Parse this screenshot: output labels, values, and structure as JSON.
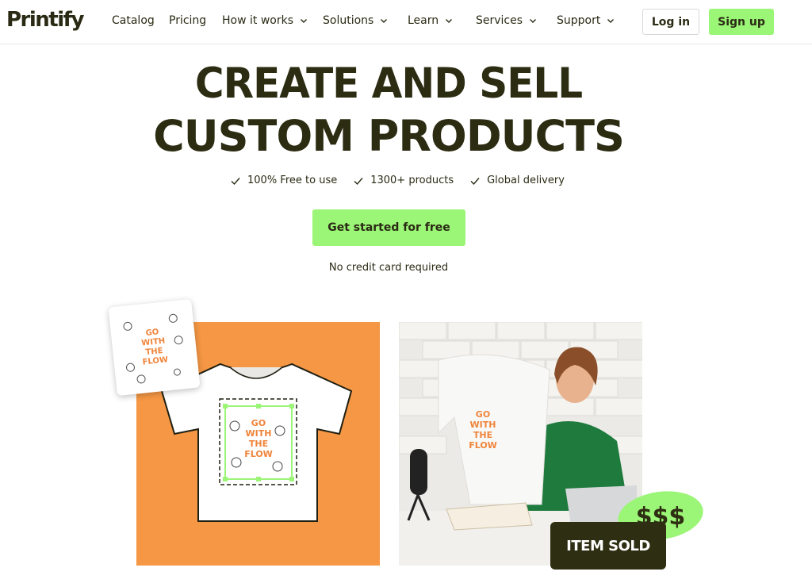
{
  "brand": {
    "logo_text": "Printify"
  },
  "nav": {
    "items": [
      {
        "label": "Catalog",
        "has_dropdown": false
      },
      {
        "label": "Pricing",
        "has_dropdown": false
      },
      {
        "label": "How it works",
        "has_dropdown": true
      },
      {
        "label": "Solutions",
        "has_dropdown": true
      },
      {
        "label": "Learn",
        "has_dropdown": true
      },
      {
        "label": "Services",
        "has_dropdown": true
      },
      {
        "label": "Support",
        "has_dropdown": true
      }
    ],
    "login_label": "Log in",
    "signup_label": "Sign up"
  },
  "hero": {
    "headline_line1": "CREATE AND SELL",
    "headline_line2": "CUSTOM PRODUCTS",
    "features": [
      {
        "icon": "check-icon",
        "label": "100% Free to use"
      },
      {
        "icon": "check-icon",
        "label": "1300+ products"
      },
      {
        "icon": "check-icon",
        "label": "Global delivery"
      }
    ],
    "cta_label": "Get started for free",
    "cta_note": "No credit card required"
  },
  "showcase": {
    "design_text": [
      "GO",
      "WITH",
      "THE",
      "FLOW"
    ],
    "sold_badge": "ITEM SOLD",
    "money_badge": "$$$"
  },
  "colors": {
    "accent_green": "#9bf576",
    "dark_olive": "#2c2c12",
    "orange": "#f59744",
    "design_orange": "#f0843a"
  }
}
